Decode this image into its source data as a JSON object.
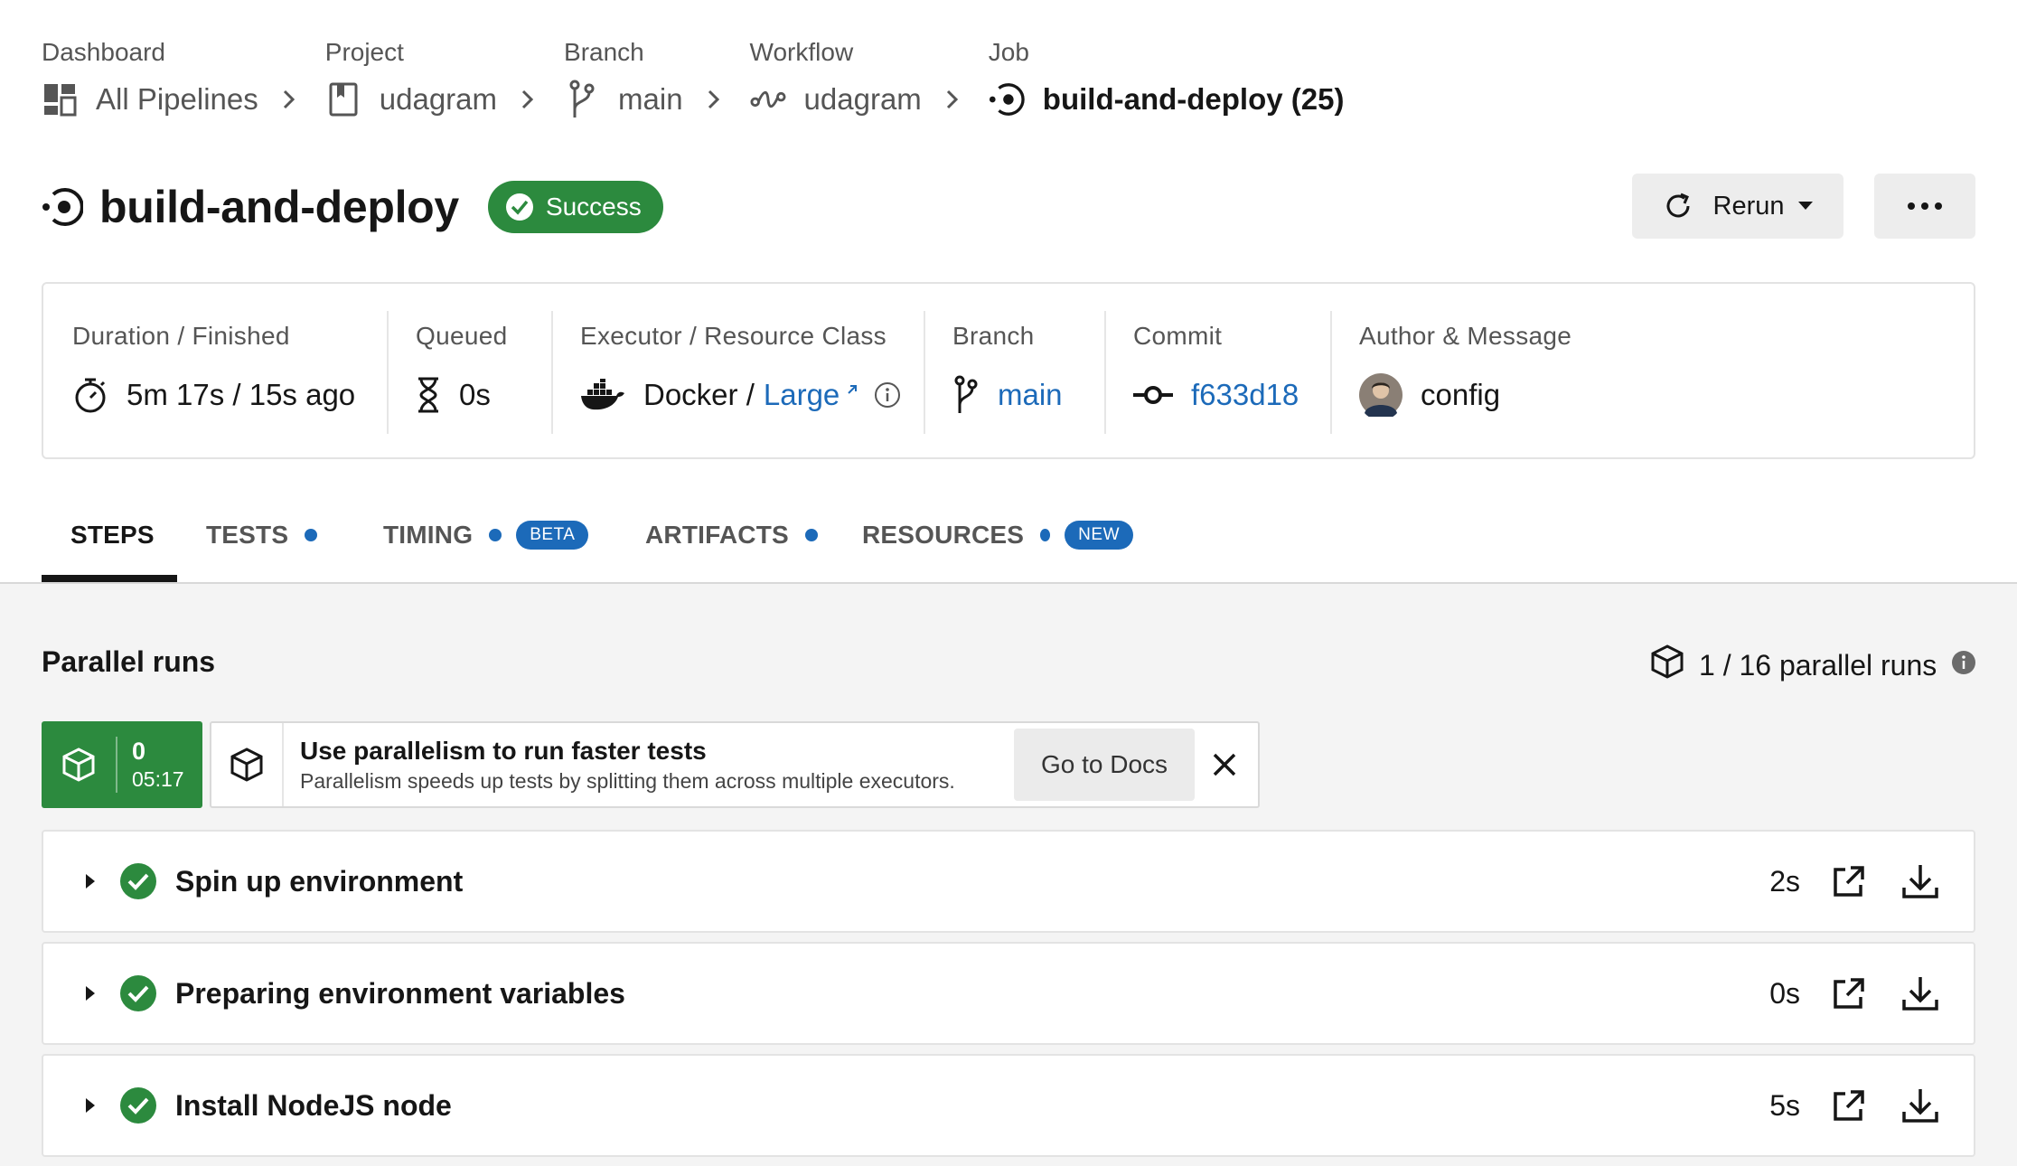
{
  "breadcrumbs": [
    {
      "category": "Dashboard",
      "value": "All Pipelines",
      "icon": "dashboard-icon"
    },
    {
      "category": "Project",
      "value": "udagram",
      "icon": "project-book-icon"
    },
    {
      "category": "Branch",
      "value": "main",
      "icon": "branch-icon"
    },
    {
      "category": "Workflow",
      "value": "udagram",
      "icon": "workflow-icon"
    },
    {
      "category": "Job",
      "value": "build-and-deploy (25)",
      "icon": "job-icon"
    }
  ],
  "job": {
    "title": "build-and-deploy",
    "status": "Success",
    "rerun_label": "Rerun"
  },
  "info": {
    "duration_label": "Duration / Finished",
    "duration_value": "5m 17s / 15s ago",
    "queued_label": "Queued",
    "queued_value": "0s",
    "executor_label": "Executor / Resource Class",
    "executor_value": "Docker /",
    "resource_class": "Large",
    "branch_label": "Branch",
    "branch_value": "main",
    "commit_label": "Commit",
    "commit_value": "f633d18",
    "author_label": "Author & Message",
    "author_message": "config"
  },
  "tabs": [
    {
      "label": "STEPS",
      "active": true
    },
    {
      "label": "TESTS",
      "dot": true
    },
    {
      "label": "TIMING",
      "dot": true,
      "tag": "BETA"
    },
    {
      "label": "ARTIFACTS",
      "dot": true
    },
    {
      "label": "RESOURCES",
      "dot": true,
      "tag": "NEW"
    }
  ],
  "parallel": {
    "title": "Parallel runs",
    "count_text": "1 / 16 parallel runs",
    "run_index": "0",
    "run_time": "05:17",
    "tip_title": "Use parallelism to run faster tests",
    "tip_body": "Parallelism speeds up tests by splitting them across multiple executors.",
    "tip_button": "Go to Docs"
  },
  "steps": [
    {
      "name": "Spin up environment",
      "duration": "2s"
    },
    {
      "name": "Preparing environment variables",
      "duration": "0s"
    },
    {
      "name": "Install NodeJS node",
      "duration": "5s"
    }
  ],
  "colors": {
    "success": "#2c8a3e",
    "link": "#1c6ab9",
    "tag": "#1c6ab9"
  }
}
